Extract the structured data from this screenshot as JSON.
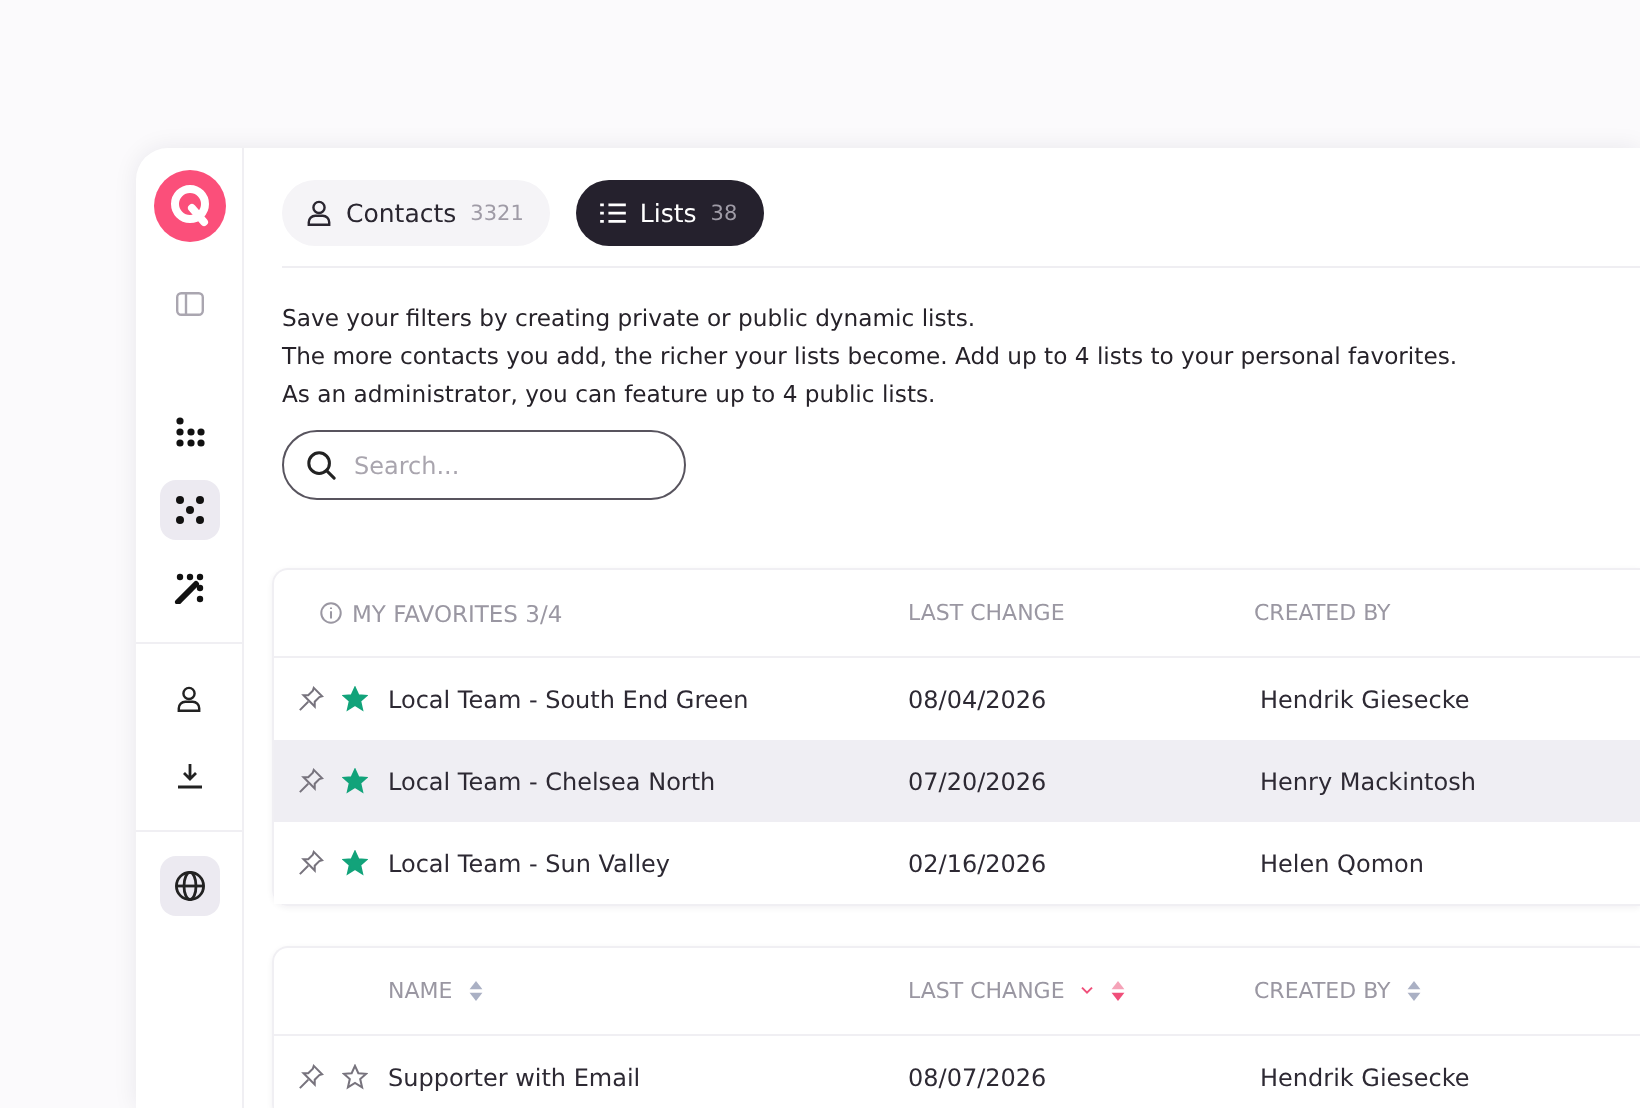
{
  "sidebar": {
    "groups": [
      {
        "items": [
          {
            "kind": "grid",
            "selected": false
          },
          {
            "kind": "cross",
            "selected": true
          },
          {
            "kind": "wand",
            "selected": false
          }
        ]
      },
      {
        "items": [
          {
            "kind": "person",
            "selected": false
          },
          {
            "kind": "download",
            "selected": false
          }
        ]
      },
      {
        "items": [
          {
            "kind": "globe",
            "selected": true
          }
        ]
      }
    ]
  },
  "tabs": [
    {
      "kind": "person",
      "label": "Contacts",
      "count": "3321",
      "selected": false
    },
    {
      "kind": "list",
      "label": "Lists",
      "count": "38",
      "selected": true
    }
  ],
  "intro": [
    "Save your filters by creating private or public dynamic lists.",
    "The more contacts you add, the richer your lists become. Add up to 4 lists to your personal favorites.",
    "As an administrator, you can feature up to 4 public lists."
  ],
  "search": {
    "placeholder": "Search..."
  },
  "favorites": {
    "columns": [
      {
        "label": "MY FAVORITES 3/4"
      },
      {
        "label": "LAST CHANGE"
      },
      {
        "label": "CREATED BY"
      }
    ],
    "rows": [
      {
        "name": "Local Team - South End Green",
        "last_change": "08/04/2026",
        "created_by": "Hendrik Giesecke",
        "favorite": true,
        "highlighted": false
      },
      {
        "name": "Local Team - Chelsea North",
        "last_change": "07/20/2026",
        "created_by": "Henry Mackintosh",
        "favorite": true,
        "highlighted": true
      },
      {
        "name": "Local Team - Sun Valley",
        "last_change": "02/16/2026",
        "created_by": "Helen Qomon",
        "favorite": true,
        "highlighted": false
      }
    ]
  },
  "lists": {
    "columns": [
      {
        "label": "NAME",
        "sorted": false
      },
      {
        "label": "LAST CHANGE",
        "sorted": true
      },
      {
        "label": "CREATED BY",
        "sorted": false
      }
    ],
    "rows": [
      {
        "name": "Supporter with Email",
        "last_change": "08/07/2026",
        "created_by": "Hendrik Giesecke",
        "favorite": false,
        "highlighted": false
      }
    ]
  }
}
